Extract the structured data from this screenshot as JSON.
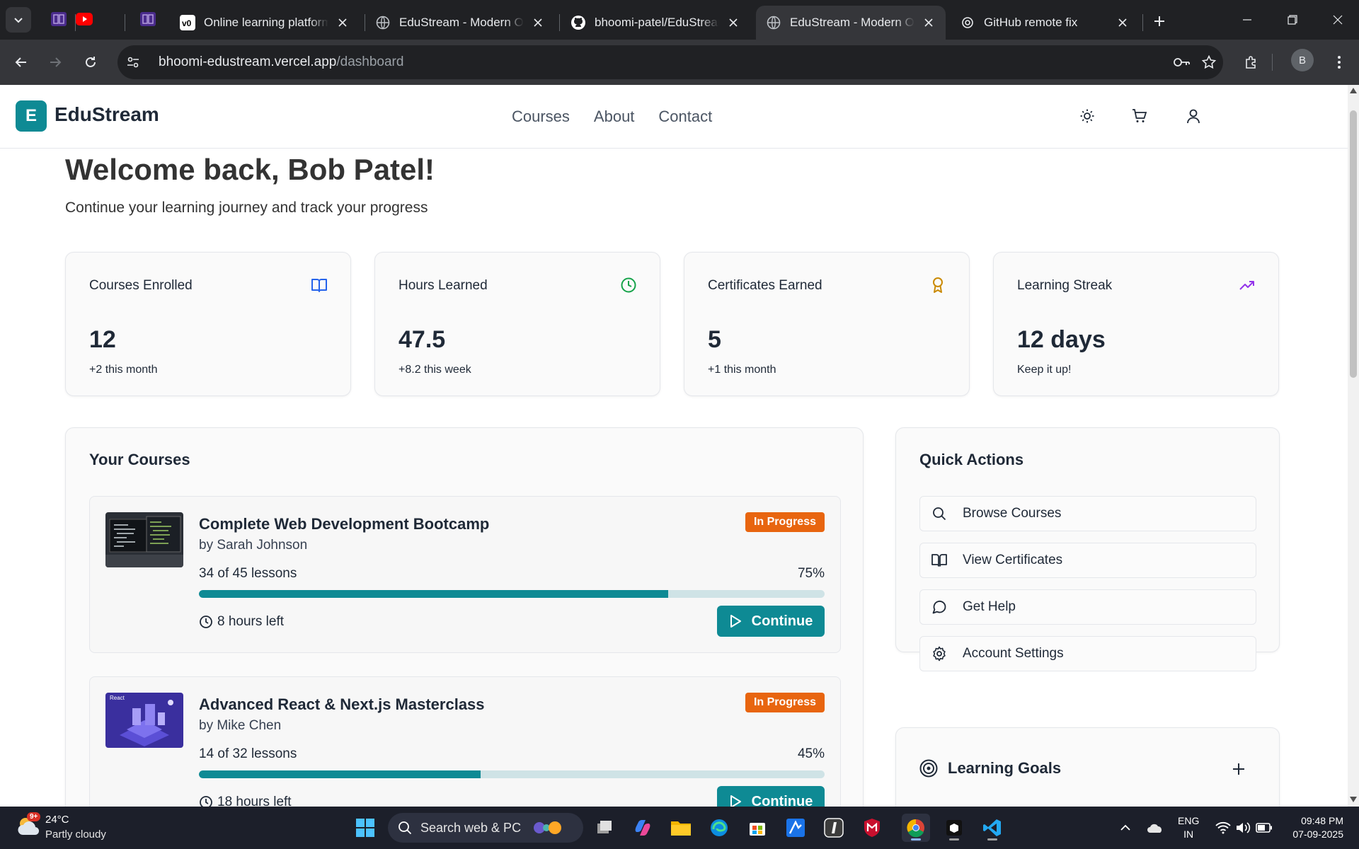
{
  "browser": {
    "tabs": [
      {
        "title": "Online learning platform",
        "active": false
      },
      {
        "title": "EduStream - Modern Online",
        "active": false
      },
      {
        "title": "bhoomi-patel/EduStream",
        "active": false
      },
      {
        "title": "EduStream - Modern Online",
        "active": true
      },
      {
        "title": "GitHub remote fix",
        "active": false
      }
    ],
    "url_host": "bhoomi-edustream.vercel.app",
    "url_path": "/dashboard",
    "profile_initial": "B"
  },
  "app": {
    "logo_letter": "E",
    "logo_text": "EduStream",
    "nav": [
      "Courses",
      "About",
      "Contact"
    ],
    "accent_color": "#0e8a94"
  },
  "welcome": {
    "title": "Welcome back, Bob Patel!",
    "subtitle": "Continue your learning journey and track your progress"
  },
  "stats": [
    {
      "label": "Courses Enrolled",
      "value": "12",
      "sub": "+2 this month",
      "icon": "book-icon",
      "color": "#2563eb"
    },
    {
      "label": "Hours Learned",
      "value": "47.5",
      "sub": "+8.2 this week",
      "icon": "clock-icon",
      "color": "#16a34a"
    },
    {
      "label": "Certificates Earned",
      "value": "5",
      "sub": "+1 this month",
      "icon": "award-icon",
      "color": "#ca8a04"
    },
    {
      "label": "Learning Streak",
      "value": "12 days",
      "sub": "Keep it up!",
      "icon": "trending-up-icon",
      "color": "#9333ea"
    }
  ],
  "courses": {
    "title": "Your Courses",
    "items": [
      {
        "title": "Complete Web Development Bootcamp",
        "author": "by Sarah Johnson",
        "status": "In Progress",
        "lessons": "34 of 45 lessons",
        "percent": "75%",
        "progress": 0.75,
        "time_left": "8 hours left",
        "button": "Continue"
      },
      {
        "title": "Advanced React & Next.js Masterclass",
        "author": "by Mike Chen",
        "status": "In Progress",
        "lessons": "14 of 32 lessons",
        "percent": "45%",
        "progress": 0.45,
        "time_left": "18 hours left",
        "button": "Continue"
      }
    ]
  },
  "quick_actions": {
    "title": "Quick Actions",
    "items": [
      {
        "label": "Browse Courses",
        "icon": "search-icon"
      },
      {
        "label": "View Certificates",
        "icon": "book-open-icon"
      },
      {
        "label": "Get Help",
        "icon": "message-circle-icon"
      },
      {
        "label": "Account Settings",
        "icon": "settings-icon"
      }
    ]
  },
  "learning_goals": {
    "title": "Learning Goals"
  },
  "taskbar": {
    "temperature": "24°C",
    "weather": "Partly cloudy",
    "weather_badge": "9+",
    "search_placeholder": "Search web & PC",
    "lang_line1": "ENG",
    "lang_line2": "IN",
    "time": "09:48 PM",
    "date": "07-09-2025"
  }
}
